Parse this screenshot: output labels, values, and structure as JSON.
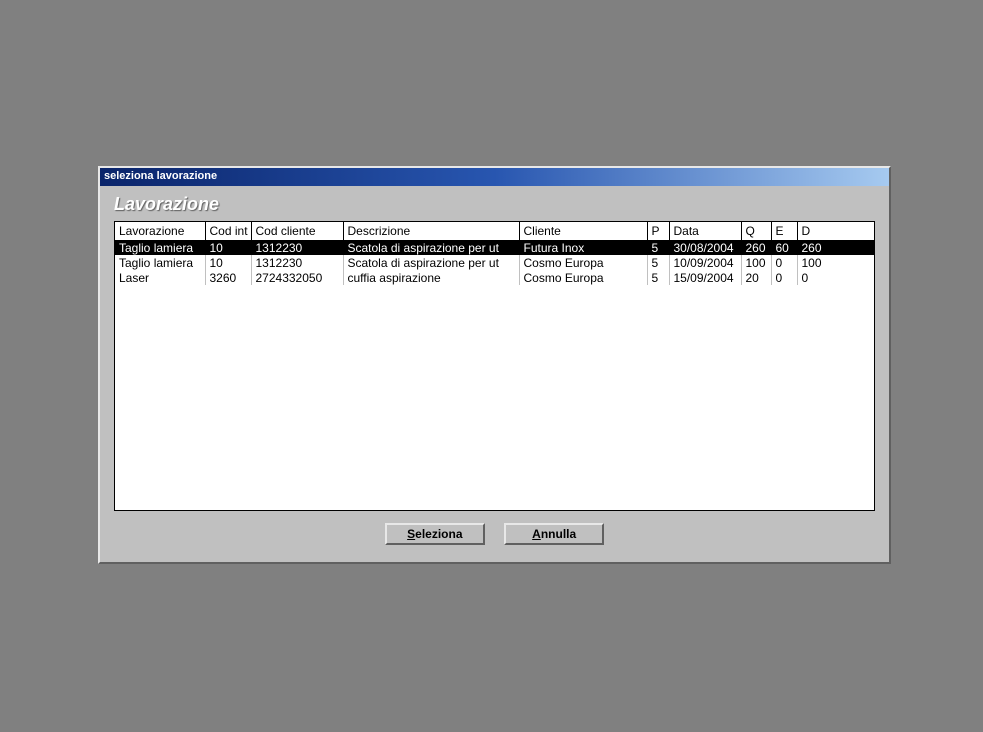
{
  "titlebar": "seleziona lavorazione",
  "heading": "Lavorazione",
  "columns": {
    "lavorazione": "Lavorazione",
    "codint": "Cod int",
    "codcliente": "Cod cliente",
    "descrizione": "Descrizione",
    "cliente": "Cliente",
    "p": "P",
    "data": "Data",
    "q": "Q",
    "e": "E",
    "d": "D"
  },
  "rows": [
    {
      "lavorazione": "Taglio lamiera",
      "codint": "10",
      "codcliente": "1312230",
      "descrizione": "Scatola di aspirazione per ut",
      "cliente": "Futura Inox",
      "p": "5",
      "data": "30/08/2004",
      "q": "260",
      "e": "60",
      "d": "260",
      "selected": true
    },
    {
      "lavorazione": "Taglio lamiera",
      "codint": "10",
      "codcliente": "1312230",
      "descrizione": "Scatola di aspirazione per ut",
      "cliente": "Cosmo Europa",
      "p": "5",
      "data": "10/09/2004",
      "q": "100",
      "e": "0",
      "d": "100",
      "selected": false
    },
    {
      "lavorazione": "Laser",
      "codint": "3260",
      "codcliente": "2724332050",
      "descrizione": "cuffia aspirazione",
      "cliente": "Cosmo Europa",
      "p": "5",
      "data": "15/09/2004",
      "q": "20",
      "e": "0",
      "d": "0",
      "selected": false
    }
  ],
  "buttons": {
    "select": "eleziona",
    "select_accel": "S",
    "cancel": "nnulla",
    "cancel_accel": "A"
  }
}
